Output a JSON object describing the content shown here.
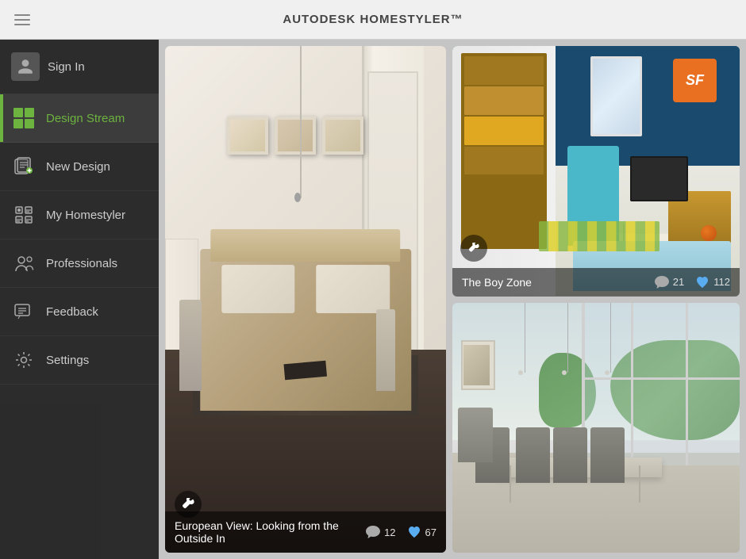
{
  "header": {
    "title_prefix": "AUTODESK ",
    "title_main": "HOMESTYLER",
    "title_suffix": "™"
  },
  "sidebar": {
    "user": {
      "label": "Sign In"
    },
    "items": [
      {
        "id": "design-stream",
        "label": "Design Stream",
        "active": true
      },
      {
        "id": "new-design",
        "label": "New Design",
        "active": false
      },
      {
        "id": "my-homestyler",
        "label": "My Homestyler",
        "active": false
      },
      {
        "id": "professionals",
        "label": "Professionals",
        "active": false
      },
      {
        "id": "feedback",
        "label": "Feedback",
        "active": false
      },
      {
        "id": "settings",
        "label": "Settings",
        "active": false
      }
    ]
  },
  "cards": {
    "left": {
      "title": "European View: Looking from the Outside In",
      "comments": "12",
      "likes": "67"
    },
    "top_right": {
      "title": "The Boy Zone",
      "comments": "21",
      "likes": "112"
    },
    "bottom_right": {
      "title": "",
      "comments": "",
      "likes": ""
    }
  },
  "icons": {
    "hamburger": "☰",
    "wrench": "🔧",
    "comment": "💬",
    "heart": "♥",
    "user": "👤"
  }
}
